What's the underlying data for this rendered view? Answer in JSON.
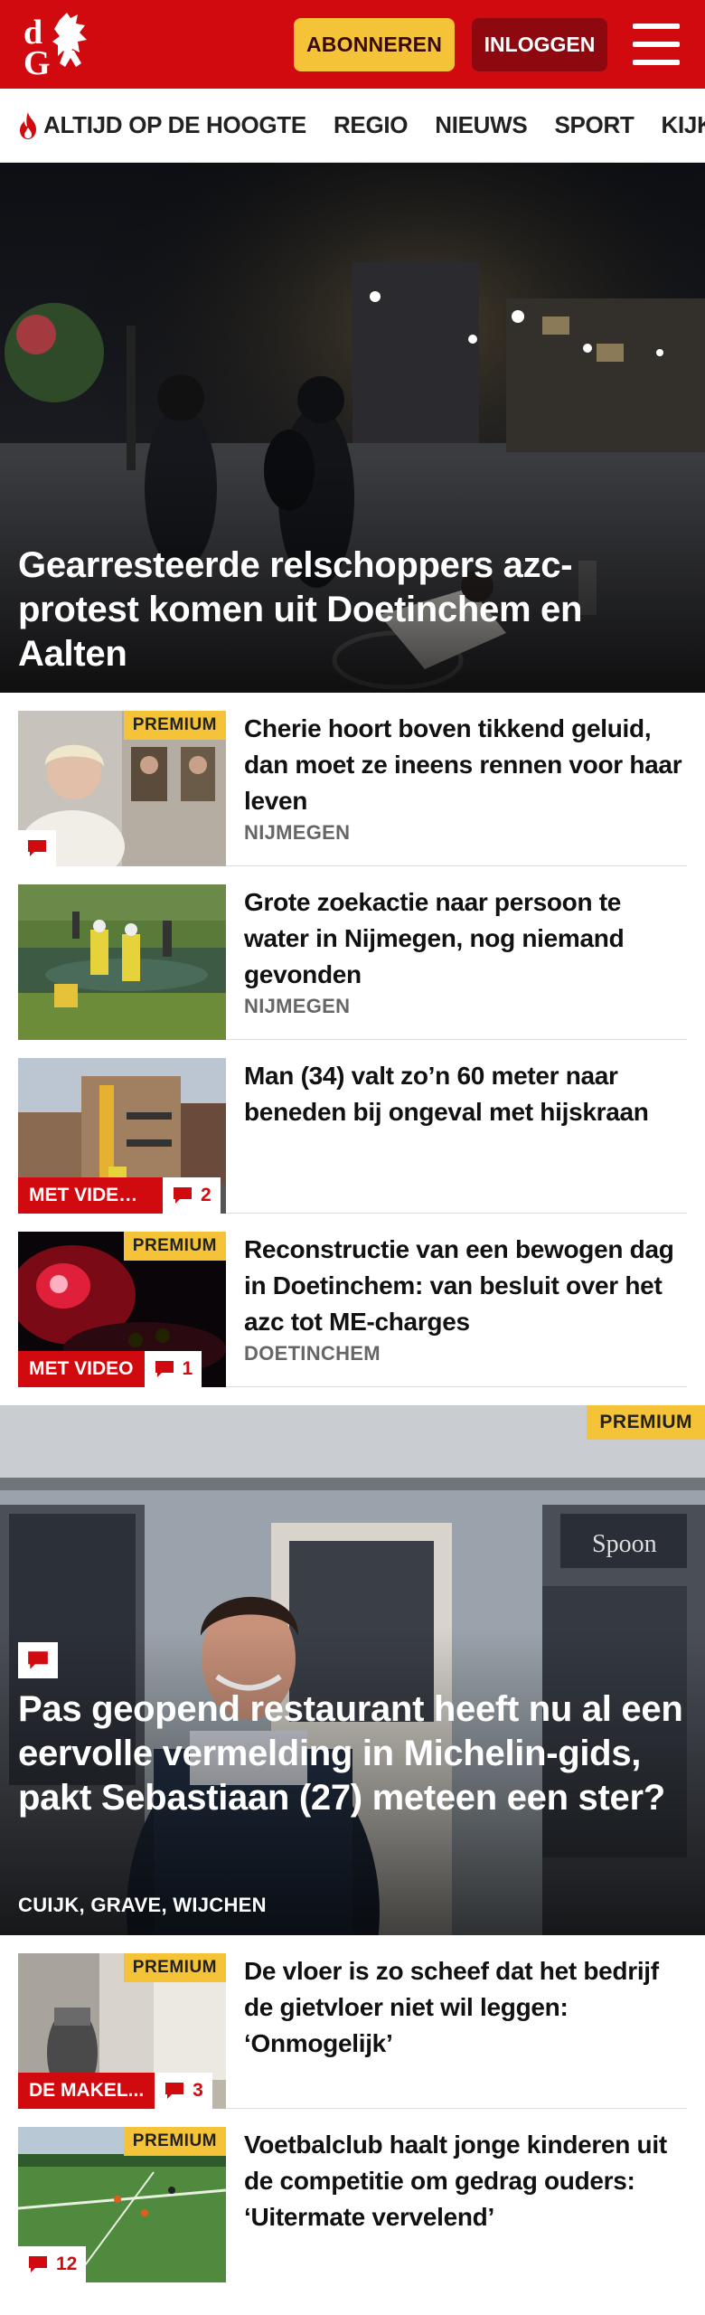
{
  "header": {
    "logo_letters": "dG",
    "subscribe_label": "ABONNEREN",
    "login_label": "INLOGGEN",
    "colors": {
      "brand_red": "#d10a10",
      "subscribe_yellow": "#f5c338",
      "login_dark_red": "#8e0810"
    }
  },
  "nav": {
    "items": [
      {
        "label": "ALTIJD OP DE HOOGTE",
        "icon": "flame-icon"
      },
      {
        "label": "REGIO"
      },
      {
        "label": "NIEUWS"
      },
      {
        "label": "SPORT"
      },
      {
        "label": "KIJK"
      }
    ]
  },
  "hero": {
    "title": "Gearresteerde relschoppers azc-protest komen uit Doetinchem en Aalten"
  },
  "articles": [
    {
      "title": "Cherie hoort boven tikkend geluid, dan moet ze ineens rennen voor haar leven",
      "location": "NIJMEGEN",
      "premium": "PREMIUM",
      "comment_icon": "comment-icon"
    },
    {
      "title": "Grote zoekactie naar persoon te water in Nijmegen, nog niemand gevonden",
      "location": "NIJMEGEN"
    },
    {
      "title": "Man (34) valt zo’n 60 meter naar beneden bij ongeval met hijskraan",
      "video": "MET VIDEO ...",
      "comments": "2"
    },
    {
      "title": "Reconstructie van een bewogen dag in Doetinchem: van besluit over het azc tot ME-charges",
      "location": "DOETINCHEM",
      "premium": "PREMIUM",
      "video": "MET VIDEO",
      "comments": "1"
    }
  ],
  "feature": {
    "premium": "PREMIUM",
    "title": "Pas geopend restaurant heeft nu al een eervolle vermelding in Michelin-gids, pakt Sebastiaan (27) meteen een ster?",
    "location": "CUIJK, GRAVE, WIJCHEN",
    "sign_text": "Spoon"
  },
  "articles2": [
    {
      "title": "De vloer is zo scheef dat het bedrijf de gietvloer niet wil leggen: ‘Onmogelijk’",
      "premium": "PREMIUM",
      "video": "DE MAKEL...",
      "comments": "3"
    },
    {
      "title": "Voetbalclub haalt jonge kinderen uit de competitie om gedrag ouders: ‘Uitermate vervelend’",
      "premium": "PREMIUM",
      "comments": "12"
    }
  ]
}
